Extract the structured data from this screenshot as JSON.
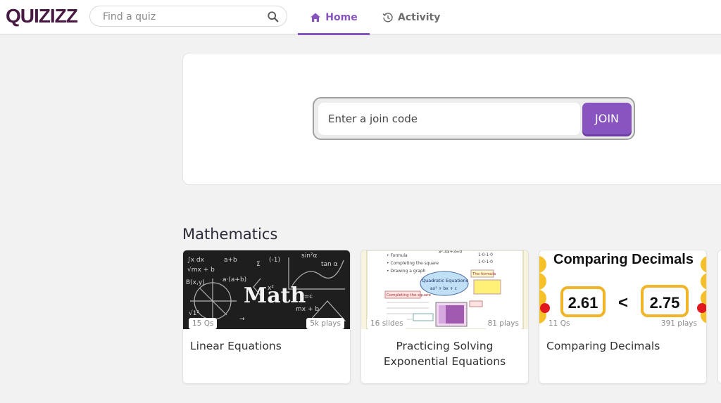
{
  "brand": {
    "logo_text": "QUIZIZZ",
    "accent": "#8854c0",
    "logo_color": "#461a42"
  },
  "search": {
    "placeholder": "Find a quiz",
    "value": "",
    "icon": "search-icon"
  },
  "nav": {
    "tabs": [
      {
        "label": "Home",
        "icon": "home-icon",
        "active": true
      },
      {
        "label": "Activity",
        "icon": "history-icon",
        "active": false
      }
    ]
  },
  "join": {
    "placeholder": "Enter a join code",
    "value": "",
    "button_label": "JOIN"
  },
  "section": {
    "title": "Mathematics",
    "cards": [
      {
        "title": "Linear Equations",
        "count": "15 Qs",
        "plays": "5k plays",
        "thumb_text": "Math"
      },
      {
        "title": "Practicing Solving Exponential Equations",
        "count": "16 slides",
        "plays": "81 plays",
        "thumb_text": "Quadratic Equations"
      },
      {
        "title": "Comparing Decimals",
        "count": "11 Qs",
        "plays": "391 plays",
        "thumb_title": "Comparing Decimals",
        "left_value": "2.61",
        "symbol": "<",
        "right_value": "2.75"
      }
    ]
  }
}
